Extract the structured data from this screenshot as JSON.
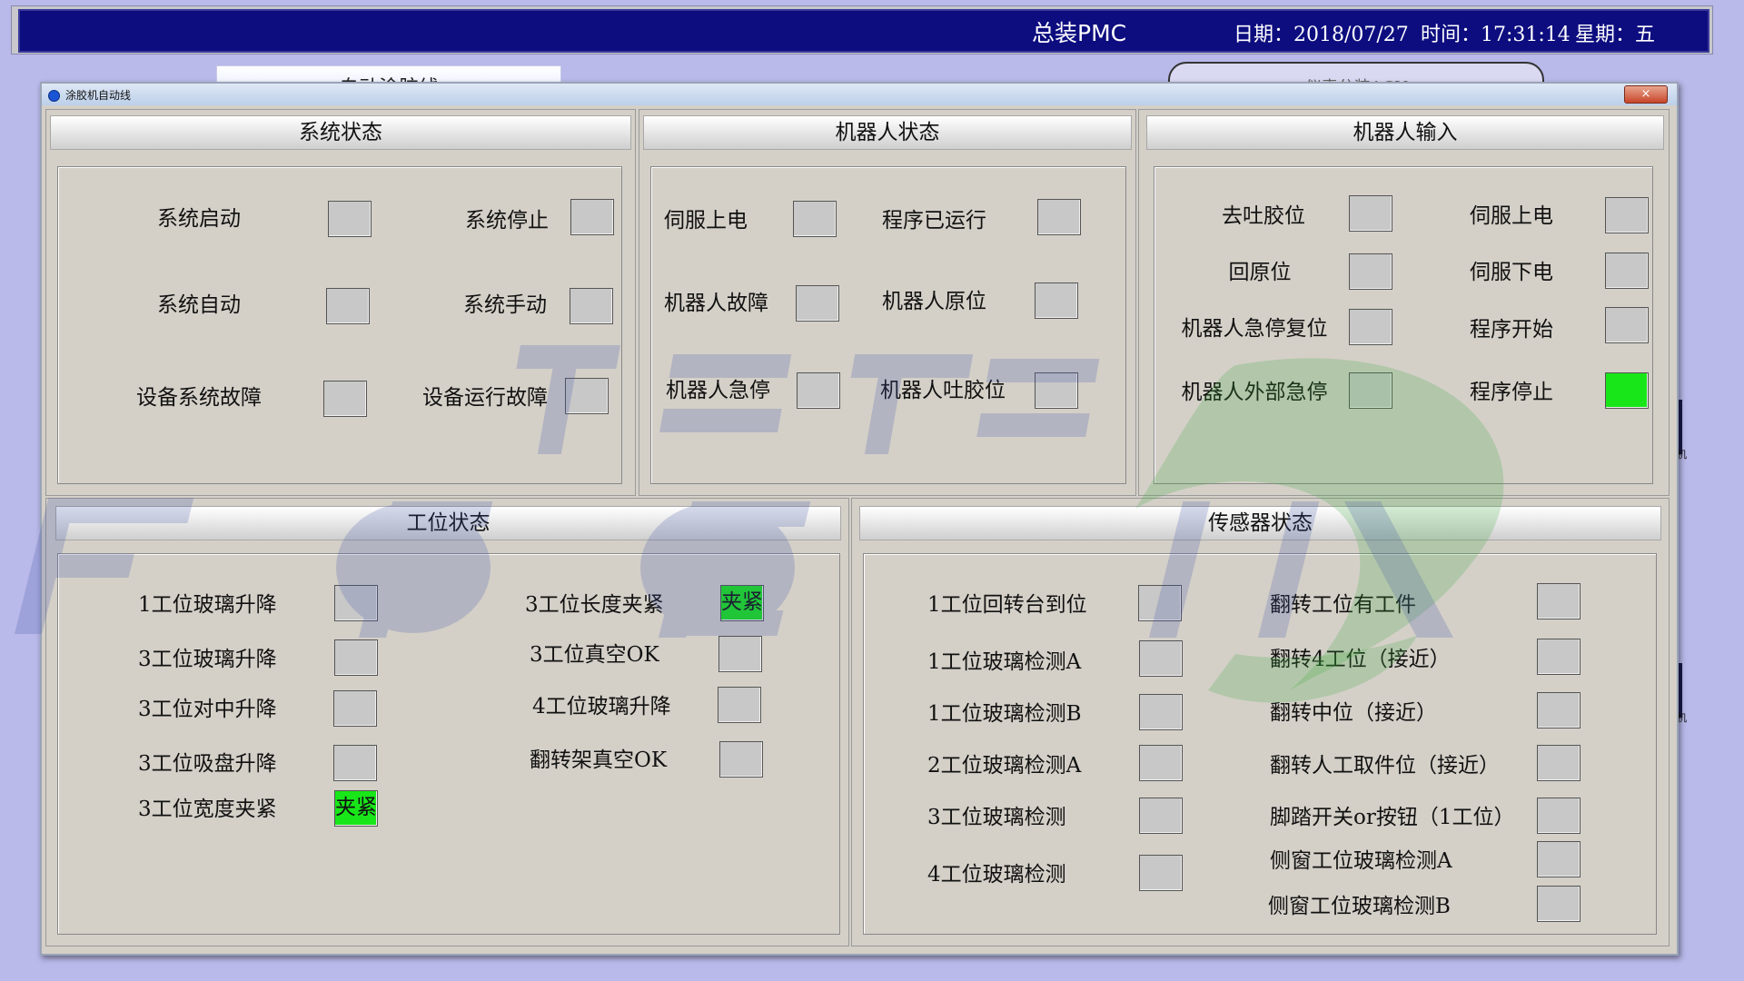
{
  "topbar": {
    "title": "总装PMC",
    "date": "日期：2018/07/27",
    "time": "时间：17:31:14",
    "weekday": "星期：五"
  },
  "background_tabs": {
    "left": "自动涂胶线",
    "right": "仪表分装AGV"
  },
  "dialog": {
    "title": "涂胶机自动线",
    "close": "×"
  },
  "panels": {
    "system": {
      "title": "系统状态",
      "items": [
        {
          "label": "系统启动",
          "on": false
        },
        {
          "label": "系统停止",
          "on": false
        },
        {
          "label": "系统自动",
          "on": false
        },
        {
          "label": "系统手动",
          "on": false
        },
        {
          "label": "设备系统故障",
          "on": false
        },
        {
          "label": "设备运行故障",
          "on": false
        }
      ]
    },
    "robot_status": {
      "title": "机器人状态",
      "items": [
        {
          "label": "伺服上电",
          "on": false
        },
        {
          "label": "程序已运行",
          "on": false
        },
        {
          "label": "机器人故障",
          "on": false
        },
        {
          "label": "机器人原位",
          "on": false
        },
        {
          "label": "机器人急停",
          "on": false
        },
        {
          "label": "机器人吐胶位",
          "on": false
        }
      ]
    },
    "robot_input": {
      "title": "机器人输入",
      "items": [
        {
          "label": "去吐胶位",
          "on": false
        },
        {
          "label": "伺服上电",
          "on": false
        },
        {
          "label": "回原位",
          "on": false
        },
        {
          "label": "伺服下电",
          "on": false
        },
        {
          "label": "机器人急停复位",
          "on": false
        },
        {
          "label": "程序开始",
          "on": false
        },
        {
          "label": "机器人外部急停",
          "on": false
        },
        {
          "label": "程序停止",
          "on": true
        }
      ]
    },
    "station": {
      "title": "工位状态",
      "items": [
        {
          "label": "1工位玻璃升降",
          "on": false,
          "text": ""
        },
        {
          "label": "3工位长度夹紧",
          "on": true,
          "text": "夹紧"
        },
        {
          "label": "3工位玻璃升降",
          "on": false,
          "text": ""
        },
        {
          "label": "3工位真空OK",
          "on": false,
          "text": ""
        },
        {
          "label": "3工位对中升降",
          "on": false,
          "text": ""
        },
        {
          "label": "4工位玻璃升降",
          "on": false,
          "text": ""
        },
        {
          "label": "3工位吸盘升降",
          "on": false,
          "text": ""
        },
        {
          "label": "翻转架真空OK",
          "on": false,
          "text": ""
        },
        {
          "label": "3工位宽度夹紧",
          "on": true,
          "text": "夹紧"
        }
      ]
    },
    "sensor": {
      "title": "传感器状态",
      "items": [
        {
          "label": "1工位回转台到位",
          "on": false
        },
        {
          "label": "翻转工位有工件",
          "on": false
        },
        {
          "label": "1工位玻璃检测A",
          "on": false
        },
        {
          "label": "翻转4工位（接近）",
          "on": false
        },
        {
          "label": "1工位玻璃检测B",
          "on": false
        },
        {
          "label": "翻转中位（接近）",
          "on": false
        },
        {
          "label": "2工位玻璃检测A",
          "on": false
        },
        {
          "label": "翻转人工取件位（接近）",
          "on": false
        },
        {
          "label": "3工位玻璃检测",
          "on": false
        },
        {
          "label": "脚踏开关or按钮（1工位）",
          "on": false
        },
        {
          "label": "4工位玻璃检测",
          "on": false
        },
        {
          "label": "侧窗工位玻璃检测A",
          "on": false
        },
        {
          "label": "侧窗工位玻璃检测B",
          "on": false
        }
      ]
    }
  },
  "side_labels": [
    "机",
    "机"
  ],
  "colors": {
    "indicator_on": "#19e619",
    "indicator_off": "#c8c8c8",
    "topbar": "#0d0d80"
  }
}
